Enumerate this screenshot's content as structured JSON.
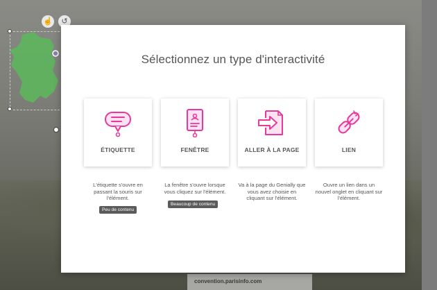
{
  "modal": {
    "title": "Sélectionnez un type d'interactivité",
    "options": [
      {
        "label": "ÉTIQUETTE",
        "icon": "speech-bubble-icon",
        "description": "L'étiquette s'ouvre en passant la souris sur l'élément.",
        "badge": "Peu de contenu"
      },
      {
        "label": "FENÊTRE",
        "icon": "window-popup-icon",
        "description": "La fenêtre s'ouvre lorsque vous cliquez sur l'élément.",
        "badge": "Beaucoup de contenu"
      },
      {
        "label": "ALLER À LA PAGE",
        "icon": "go-to-page-icon",
        "description": "Va à la page du Genially que vous avez choisie en cliquant sur l'élément."
      },
      {
        "label": "LIEN",
        "icon": "chain-link-icon",
        "description": "Ouvre un lien dans un nouvel onglet en cliquant sur l'élément."
      }
    ]
  },
  "background": {
    "footer_text": "convention.parisinfo.com"
  },
  "colors": {
    "accent": "#e6399b",
    "card_text": "#555555",
    "map_green": "#5cb85c"
  }
}
